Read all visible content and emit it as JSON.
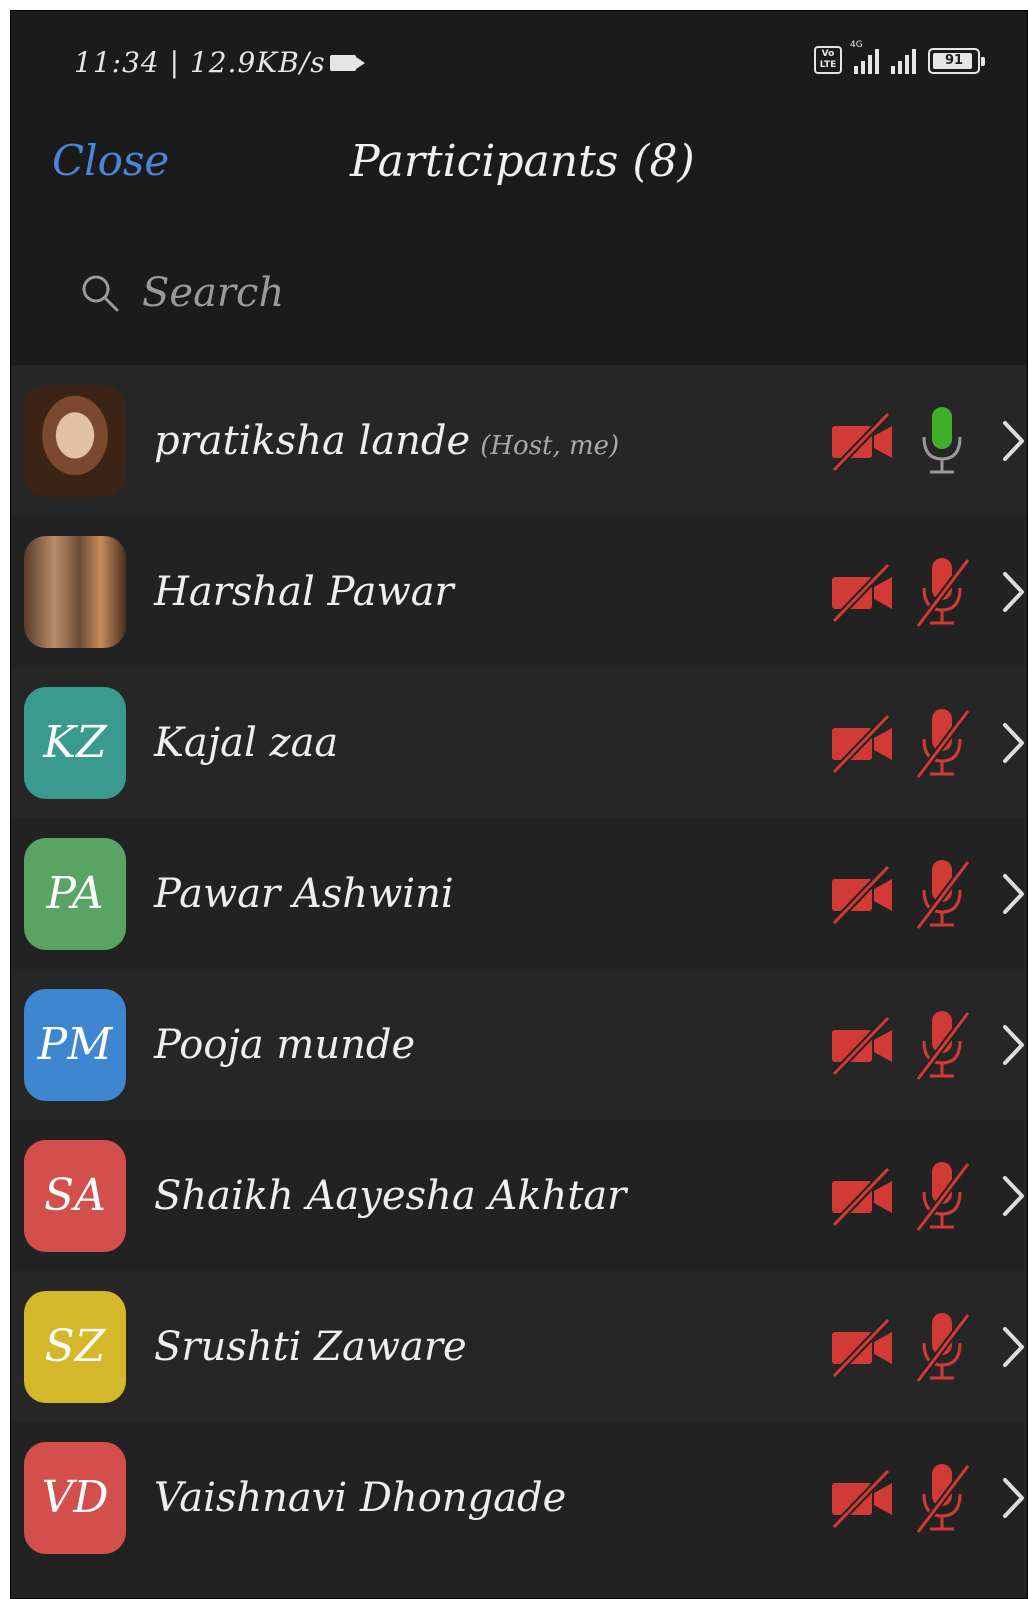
{
  "status_bar": {
    "time_speed": "11:34 | 12.9KB/s",
    "volte": "Vo LTE",
    "network_tag": "4G",
    "battery": "91"
  },
  "header": {
    "close_label": "Close",
    "title": "Participants (8)"
  },
  "search": {
    "placeholder": "Search"
  },
  "participants": [
    {
      "name": "pratiksha lande",
      "role": "(Host, me)",
      "initials": "",
      "avatar_type": "photo",
      "avatar_color": "",
      "video": "off",
      "audio": "on"
    },
    {
      "name": "Harshal Pawar",
      "role": "",
      "initials": "",
      "avatar_type": "photo",
      "avatar_color": "",
      "video": "off",
      "audio": "muted"
    },
    {
      "name": "Kajal zaa",
      "role": "",
      "initials": "KZ",
      "avatar_type": "initials",
      "avatar_color": "#3a9a8f",
      "video": "off",
      "audio": "muted"
    },
    {
      "name": "Pawar Ashwini",
      "role": "",
      "initials": "PA",
      "avatar_type": "initials",
      "avatar_color": "#5aa463",
      "video": "off",
      "audio": "muted"
    },
    {
      "name": "Pooja munde",
      "role": "",
      "initials": "PM",
      "avatar_type": "initials",
      "avatar_color": "#3f86d0",
      "video": "off",
      "audio": "muted"
    },
    {
      "name": "Shaikh Aayesha Akhtar",
      "role": "",
      "initials": "SA",
      "avatar_type": "initials",
      "avatar_color": "#d24f4b",
      "video": "off",
      "audio": "muted"
    },
    {
      "name": "Srushti Zaware",
      "role": "",
      "initials": "SZ",
      "avatar_type": "initials",
      "avatar_color": "#d4b72a",
      "video": "off",
      "audio": "muted"
    },
    {
      "name": "Vaishnavi Dhongade",
      "role": "",
      "initials": "VD",
      "avatar_type": "initials",
      "avatar_color": "#d24f4b",
      "video": "off",
      "audio": "muted"
    }
  ],
  "colors": {
    "muted_red": "#d23a35",
    "mic_on_green": "#3fae29",
    "link_blue": "#4a86d8",
    "background": "#222222",
    "row_alt": "#262626"
  },
  "icons": {
    "video_off": "video-off-icon",
    "mic_muted": "mic-muted-icon",
    "mic_on": "mic-on-icon",
    "chevron": "chevron-right-icon",
    "search": "search-icon"
  }
}
